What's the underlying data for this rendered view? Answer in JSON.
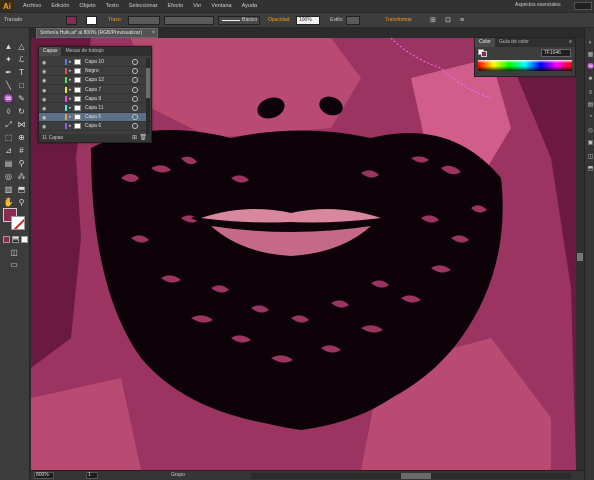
{
  "app": {
    "logo": "Ai",
    "brand_color": "#f7a21b"
  },
  "menu": [
    "Archivo",
    "Edición",
    "Objeto",
    "Texto",
    "Seleccionar",
    "Efecto",
    "Ver",
    "Ventana",
    "Ayuda"
  ],
  "workspace": "Aspectos esenciales",
  "control_bar": {
    "selection_label": "Trazado",
    "stroke_label": "Trazo:",
    "brush_label": "Básico",
    "opacity_label": "Opacidad:",
    "opacity_value": "100%",
    "style_label": "Estilo:",
    "transform_label": "Transformar"
  },
  "document_tab": {
    "title": "Sinfonía Hulk.ai* al 800% (RGB/Previsualizar)",
    "close": "×"
  },
  "layers_panel": {
    "tabs": [
      "Capas",
      "Mesas de trabajo"
    ],
    "rows": [
      {
        "name": "Capa 10",
        "color": "#4f7ce8",
        "selected": false
      },
      {
        "name": "Negro",
        "color": "#e84f4f",
        "selected": false
      },
      {
        "name": "Capa 12",
        "color": "#4fe84f",
        "selected": false
      },
      {
        "name": "Capa 7",
        "color": "#e8e84f",
        "selected": false
      },
      {
        "name": "Capa 9",
        "color": "#e84fe8",
        "selected": false
      },
      {
        "name": "Capa 11",
        "color": "#4fe8e8",
        "selected": false
      },
      {
        "name": "Capa 5",
        "color": "#e8a04f",
        "selected": true
      },
      {
        "name": "Capa 6",
        "color": "#a04fe8",
        "selected": false
      }
    ],
    "footer": "11 Capas"
  },
  "color_panel": {
    "tabs": [
      "Color",
      "Guía de color"
    ],
    "hex_value": "7F1046"
  },
  "status_bar": {
    "zoom": "800%",
    "page": "1",
    "tool": "Grupo"
  },
  "colors": {
    "fill": "#8b2b54",
    "stroke": "#ffffff",
    "canvas_bg": "#7a2049",
    "skin_light": "#b94a72",
    "skin_mid": "#9c3462",
    "skin_dark": "#6a1a40",
    "beard": "#0d0208",
    "highlight": "#d05d8a"
  },
  "icons": [
    "selection-icon",
    "direct-selection-icon",
    "magic-wand-icon",
    "lasso-icon",
    "pen-icon",
    "type-icon",
    "line-icon",
    "rectangle-icon",
    "paintbrush-icon",
    "pencil-icon",
    "eraser-icon",
    "rotate-icon",
    "scale-icon",
    "width-icon",
    "free-transform-icon",
    "shape-builder-icon",
    "perspective-icon",
    "mesh-icon",
    "gradient-icon",
    "eyedropper-icon",
    "blend-icon",
    "symbol-sprayer-icon",
    "graph-icon",
    "artboard-icon",
    "slice-icon",
    "hand-icon",
    "zoom-icon"
  ]
}
